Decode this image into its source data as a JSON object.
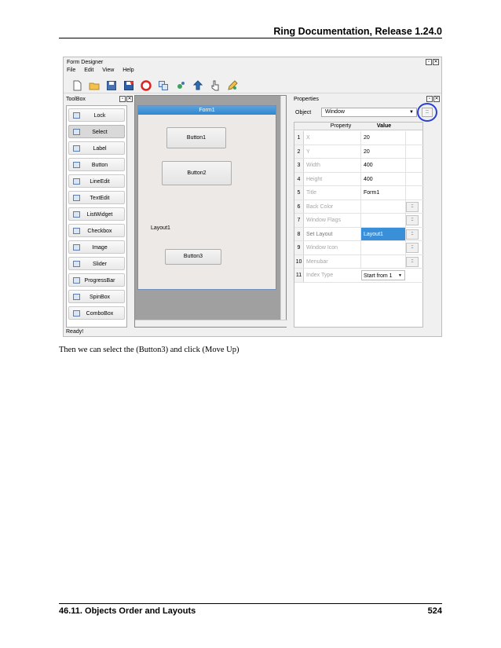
{
  "page": {
    "header": "Ring Documentation, Release 1.24.0",
    "caption": "Then we can select the (Button3) and click (Move Up)",
    "footer_section": "46.11. Objects Order and Layouts",
    "footer_page": "524"
  },
  "window": {
    "title": "Form Designer",
    "menu": [
      "File",
      "Edit",
      "View",
      "Help"
    ],
    "toolbar_icons": [
      "new-file-icon",
      "open-folder-icon",
      "save-icon",
      "save-as-icon",
      "close-icon",
      "copy-icon",
      "run-icon",
      "move-up-icon",
      "move-down-icon",
      "pencil-icon"
    ],
    "status": "Ready!"
  },
  "toolbox": {
    "title": "ToolBox",
    "items": [
      "Lock",
      "Select",
      "Label",
      "Button",
      "LineEdit",
      "TextEdit",
      "ListWidget",
      "Checkbox",
      "Image",
      "Slider",
      "ProgressBar",
      "SpinBox",
      "ComboBox"
    ],
    "selected": "Select"
  },
  "form": {
    "title": "Form1",
    "buttons": [
      "Button1",
      "Button2",
      "Button3"
    ],
    "layout_label": "Layout1"
  },
  "properties": {
    "title": "Properties",
    "object_label": "Object",
    "object_value": "Window",
    "dots_label": "::",
    "col_property": "Property",
    "col_value": "Value",
    "rows": [
      {
        "num": "1",
        "name": "X",
        "value": "20",
        "extra": ""
      },
      {
        "num": "2",
        "name": "Y",
        "value": "20",
        "extra": ""
      },
      {
        "num": "3",
        "name": "Width",
        "value": "400",
        "extra": ""
      },
      {
        "num": "4",
        "name": "Height",
        "value": "400",
        "extra": ""
      },
      {
        "num": "5",
        "name": "Title",
        "value": "Form1",
        "extra": ""
      },
      {
        "num": "6",
        "name": "Back Color",
        "value": "",
        "extra": "::"
      },
      {
        "num": "7",
        "name": "Window Flags",
        "value": "",
        "extra": "::"
      },
      {
        "num": "8",
        "name": "Set Layout",
        "value": "Layout1",
        "extra": "::"
      },
      {
        "num": "9",
        "name": "Window Icon",
        "value": "",
        "extra": "::"
      },
      {
        "num": "10",
        "name": "Menubar",
        "value": "",
        "extra": "::"
      },
      {
        "num": "11",
        "name": "Index Type",
        "value": "Start from 1",
        "extra": ""
      }
    ],
    "selected_row": "8"
  }
}
